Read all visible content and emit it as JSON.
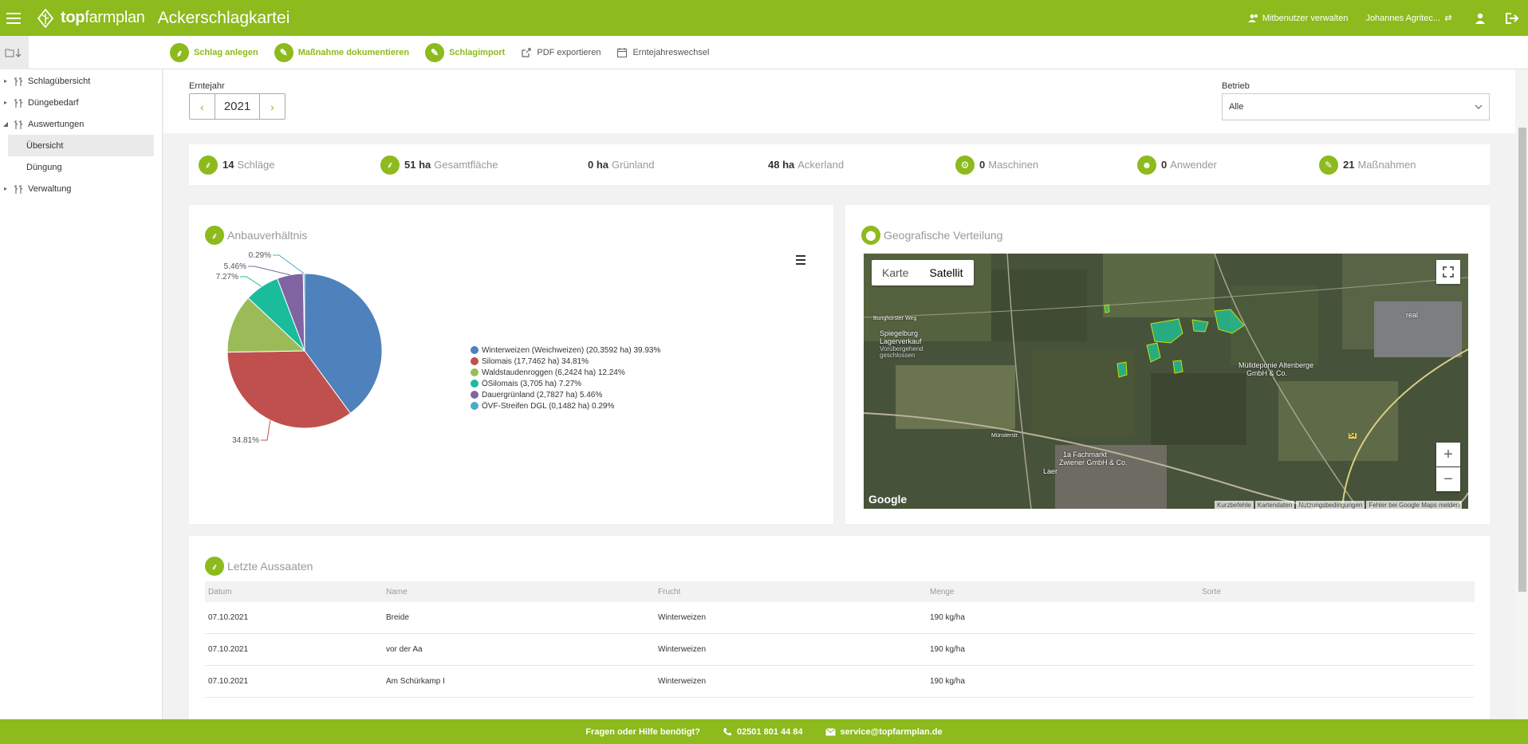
{
  "header": {
    "brand_bold": "top",
    "brand_light": "farmplan",
    "app_title": "Ackerschlagkartei",
    "manage_users": "Mitbenutzer verwalten",
    "user_name": "Johannes Agritec..."
  },
  "toolbar": {
    "add_field": "Schlag anlegen",
    "document_measure": "Maßnahme dokumentieren",
    "field_import": "Schlagimport",
    "pdf_export": "PDF exportieren",
    "harvest_year_change": "Erntejahreswechsel"
  },
  "sidebar": {
    "items": [
      {
        "label": "Schlagübersicht"
      },
      {
        "label": "Düngebedarf"
      },
      {
        "label": "Auswertungen"
      },
      {
        "label": "Übersicht"
      },
      {
        "label": "Düngung"
      },
      {
        "label": "Verwaltung"
      }
    ]
  },
  "filters": {
    "year_label": "Erntejahr",
    "year_value": "2021",
    "betrieb_label": "Betrieb",
    "betrieb_value": "Alle"
  },
  "stats": {
    "schlaege_num": "14",
    "schlaege_txt": "Schläge",
    "flaeche_num": "51 ha",
    "flaeche_txt": "Gesamtfläche",
    "gruen_num": "0 ha",
    "gruen_txt": "Grünland",
    "acker_num": "48 ha",
    "acker_txt": "Ackerland",
    "masch_num": "0",
    "masch_txt": "Maschinen",
    "anw_num": "0",
    "anw_txt": "Anwender",
    "mass_num": "21",
    "mass_txt": "Maßnahmen"
  },
  "pie_card": {
    "title": "Anbauverhältnis"
  },
  "map_card": {
    "title": "Geografische Verteilung",
    "tab_map": "Karte",
    "tab_satellite": "Satellit",
    "google": "Google",
    "attr_shortcuts": "Kurzbefehle",
    "attr_mapdata": "Kartendaten",
    "attr_terms": "Nutzungsbedingungen",
    "attr_report": "Fehler bei Google Maps melden",
    "poi_1_a": "Spiegelburg",
    "poi_1_b": "Lagerverkauf",
    "poi_1_c": "Vorübergehend",
    "poi_1_d": "geschlossen",
    "poi_2_a": "Mülldeponie Altenberge",
    "poi_2_b": "GmbH & Co.",
    "poi_3_a": "1a Fachmarkt",
    "poi_3_b": "Zwiener GmbH & Co.",
    "poi_4": "real",
    "road_1": "Bunghorster Weg",
    "road_2": "Laer",
    "road_3": "Münsterstr.",
    "road_4": "54"
  },
  "chart_data": {
    "type": "pie",
    "title": "Anbauverhältnis",
    "series": [
      {
        "name": "Winterweizen (Weichweizen)",
        "area_ha": 20.3592,
        "percent": 39.93,
        "color": "#4f81bd",
        "legend": "Winterweizen (Weichweizen) (20,3592 ha) 39.93%"
      },
      {
        "name": "Silomais",
        "area_ha": 17.7462,
        "percent": 34.81,
        "color": "#c0504d",
        "legend": "Silomais  (17,7462 ha) 34.81%"
      },
      {
        "name": "Waldstaudenroggen",
        "area_ha": 6.2424,
        "percent": 12.24,
        "color": "#9bbb59",
        "legend": "Waldstaudenroggen (6,2424 ha) 12.24%"
      },
      {
        "name": "ÖSilomais",
        "area_ha": 3.705,
        "percent": 7.27,
        "color": "#1abc9c",
        "legend": "ÖSilomais  (3,705 ha) 7.27%"
      },
      {
        "name": "Dauergrünland",
        "area_ha": 2.7827,
        "percent": 5.46,
        "color": "#8064a2",
        "legend": "Dauergrünland (2,7827 ha) 5.46%"
      },
      {
        "name": "ÖVF-Streifen DGL",
        "area_ha": 0.1482,
        "percent": 0.29,
        "color": "#4bacc6",
        "legend": "ÖVF-Streifen DGL (0,1482 ha) 0.29%"
      }
    ],
    "data_labels": [
      "34.81%",
      "0.29%",
      "5.46%",
      "7.27%"
    ],
    "legend_position": "right"
  },
  "table": {
    "title": "Letzte Aussaaten",
    "columns": [
      "Datum",
      "Name",
      "Frucht",
      "Menge",
      "Sorte"
    ],
    "rows": [
      [
        "07.10.2021",
        "Breide",
        "Winterweizen",
        "190 kg/ha",
        ""
      ],
      [
        "07.10.2021",
        "vor der Aa",
        "Winterweizen",
        "190 kg/ha",
        ""
      ],
      [
        "07.10.2021",
        "Am Schürkamp I",
        "Winterweizen",
        "190 kg/ha",
        ""
      ]
    ]
  },
  "footer": {
    "help": "Fragen oder Hilfe benötigt?",
    "phone": "02501 801 44 84",
    "email": "service@topfarmplan.de"
  },
  "colors": {
    "brand": "#8dba1c"
  }
}
